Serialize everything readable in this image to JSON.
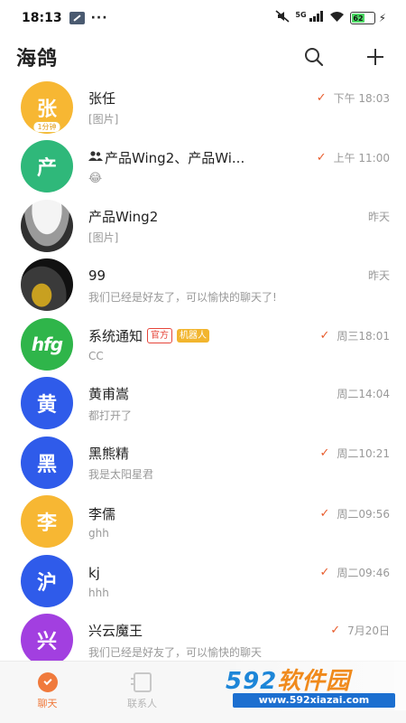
{
  "status_bar": {
    "time": "18:13",
    "dots": "···",
    "network_label": "5G",
    "battery": "62",
    "battery_level": 0.62
  },
  "header": {
    "title": "海鸽",
    "search_icon": "search-icon",
    "add_icon": "plus-icon"
  },
  "chats": [
    {
      "avatar_text": "张",
      "avatar_color": "#f7b733",
      "avatar_badge": "1分钟",
      "name": "张任",
      "time": "下午 18:03",
      "preview": "[图片]",
      "check": "✓"
    },
    {
      "avatar_text": "产",
      "avatar_color": "#2fb87a",
      "name": "产品Wing2、产品Wi...",
      "time": "上午 11:00",
      "preview": "😂",
      "check": "✓"
    },
    {
      "name": "产品Wing2",
      "time": "昨天",
      "preview": "[图片]"
    },
    {
      "name": "99",
      "time": "昨天",
      "preview": "我们已经是好友了，可以愉快的聊天了!"
    },
    {
      "avatar_text": "hfg",
      "name": "系统通知",
      "tag_official": "官方",
      "tag_robot": "机器人",
      "time": "周三18:01",
      "preview": "CC",
      "check": "✓"
    },
    {
      "avatar_text": "黄",
      "avatar_color": "#2f5bea",
      "name": "黄甫嵩",
      "time": "周二14:04",
      "preview": "都打开了"
    },
    {
      "avatar_text": "黑",
      "avatar_color": "#2f5bea",
      "name": "黑熊精",
      "time": "周二10:21",
      "preview": "我是太阳星君",
      "check": "✓"
    },
    {
      "avatar_text": "李",
      "avatar_color": "#f7b733",
      "name": "李儒",
      "time": "周二09:56",
      "preview": "ghh",
      "check": "✓"
    },
    {
      "avatar_text": "沪",
      "avatar_color": "#2f5bea",
      "name": "kj",
      "time": "周二09:46",
      "preview": "hhh",
      "check": "✓"
    },
    {
      "avatar_text": "兴",
      "avatar_color": "#a23fe0",
      "name": "兴云魔王",
      "time": "7月20日",
      "preview": "我们已经是好友了，可以愉快的聊天",
      "check": "✓"
    }
  ],
  "tabs": [
    {
      "label": "聊天",
      "active": true
    },
    {
      "label": "联系人",
      "active": false
    }
  ],
  "watermark": {
    "main": "592",
    "accent": "软件园",
    "url": "www.592xiazai.com"
  },
  "colors": {
    "accent": "#f07a3c",
    "check": "#e85c2c",
    "tag_official": "#e6453a",
    "tag_robot": "#f2b52e"
  }
}
